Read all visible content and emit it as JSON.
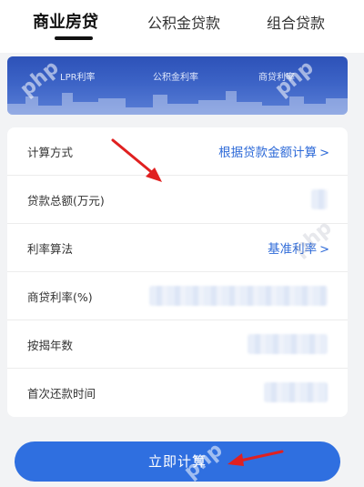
{
  "tabs": {
    "items": [
      {
        "label": "商业房贷",
        "active": true
      },
      {
        "label": "公积金贷款",
        "active": false
      },
      {
        "label": "组合贷款",
        "active": false
      }
    ]
  },
  "banner": {
    "labels": [
      "LPR利率",
      "公积金利率",
      "商贷利率"
    ]
  },
  "form": {
    "rows": [
      {
        "label": "计算方式",
        "value": "根据贷款金额计算",
        "type": "link"
      },
      {
        "label": "贷款总额(万元)",
        "value": "",
        "type": "blurred"
      },
      {
        "label": "利率算法",
        "value": "基准利率",
        "type": "link"
      },
      {
        "label": "商贷利率(%)",
        "value": "",
        "type": "blurred"
      },
      {
        "label": "按揭年数",
        "value": "",
        "type": "blurred"
      },
      {
        "label": "首次还款时间",
        "value": "",
        "type": "blurred"
      }
    ],
    "chevron": ">"
  },
  "submit": {
    "label": "立即计算"
  },
  "watermark": "php",
  "colors": {
    "accent": "#2f6fe0",
    "link": "#2f6bd8",
    "annotation": "#e02020"
  }
}
